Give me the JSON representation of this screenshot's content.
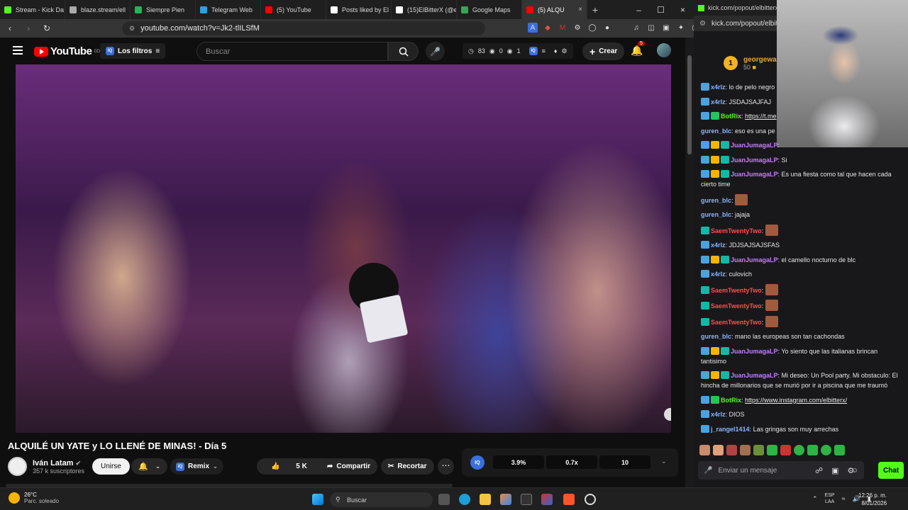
{
  "browser": {
    "tabs": [
      {
        "label": "Stream - Kick Da",
        "color": "#53fc18"
      },
      {
        "label": "blaze.stream/ell",
        "color": "#aaaaaa"
      },
      {
        "label": "Siempre Pien",
        "color": "#1db954"
      },
      {
        "label": "Telegram Web",
        "color": "#2aa3de"
      },
      {
        "label": "(5) YouTube",
        "color": "#ff0000"
      },
      {
        "label": "Posts liked by El",
        "color": "#ffffff"
      },
      {
        "label": "(15)ElBitterX (@e",
        "color": "#ffffff"
      },
      {
        "label": "Google Maps",
        "color": "#34a853"
      },
      {
        "label": "(5) ALQU",
        "color": "#ff0000"
      }
    ],
    "url": "youtube.com/watch?v=Jk2-tlILSfM"
  },
  "youtube": {
    "logo_text": "YouTube",
    "logo_country": "CO",
    "filter_label": "Los filtros",
    "search_placeholder": "Buscar",
    "stats": {
      "a": "83",
      "b": "0",
      "c": "1"
    },
    "create_label": "Crear",
    "notif_count": "5",
    "video_title": "ALQUILÉ UN YATE y LO LLENÉ DE MINAS! - Día 5",
    "channel_name": "Iván Latam",
    "subscribers": "357 k suscriptores",
    "join_label": "Unirse",
    "remix_label": "Remix",
    "likes": "5 K",
    "share_label": "Compartir",
    "clip_label": "Recortar",
    "speed": {
      "v1": "3.9%",
      "v2": "0.7x",
      "v3": "10"
    }
  },
  "kick": {
    "tab_url": "kick.com/popout/elbitterx/c",
    "url": "kick.com/popout/elbitterx/c",
    "gift_user": "georgewas",
    "gift_amount": "50",
    "messages": [
      {
        "user": "x4rlz",
        "color": "#8ab4ff",
        "text": "lo de pelo negro",
        "badges": [
          "#4aa3df"
        ]
      },
      {
        "user": "x4rlz",
        "color": "#8ab4ff",
        "text": "JSDAJSAJFAJ",
        "badges": [
          "#4aa3df"
        ]
      },
      {
        "user": "BotRix",
        "color": "#53fc18",
        "link": "https://t.me",
        "badges": [
          "#4aa3df",
          "#22c55e"
        ]
      },
      {
        "user": "guren_blc",
        "color": "#8ab4ff",
        "text": "eso es una pe",
        "badges": []
      },
      {
        "user": "JuanJumagaLP",
        "color": "#c77dff",
        "text": "",
        "badges": [
          "#4aa3df",
          "#f5b400",
          "#14b8a6"
        ]
      },
      {
        "user": "JuanJumagaLP",
        "color": "#c77dff",
        "text": "Si",
        "badges": [
          "#4aa3df",
          "#f5b400",
          "#14b8a6"
        ]
      },
      {
        "user": "JuanJumagaLP",
        "color": "#c77dff",
        "text": "Es una fiesta como tal que hacen cada cierto time",
        "badges": [
          "#4aa3df",
          "#f5b400",
          "#14b8a6"
        ]
      },
      {
        "user": "guren_blc",
        "color": "#8ab4ff",
        "emote": true,
        "badges": []
      },
      {
        "user": "guren_blc",
        "color": "#8ab4ff",
        "text": "jajaja",
        "badges": []
      },
      {
        "user": "SaemTwentyTwo",
        "color": "#ff4d4d",
        "emote": true,
        "badges": [
          "#14b8a6"
        ]
      },
      {
        "user": "x4rlz",
        "color": "#8ab4ff",
        "text": "JDJSAJSAJSFAS",
        "badges": [
          "#4aa3df"
        ]
      },
      {
        "user": "JuanJumagaLP",
        "color": "#c77dff",
        "text": "el camello nocturno de blc",
        "badges": [
          "#4aa3df",
          "#f5b400",
          "#14b8a6"
        ]
      },
      {
        "user": "x4rlz",
        "color": "#8ab4ff",
        "text": "culovich",
        "badges": [
          "#4aa3df"
        ]
      },
      {
        "user": "SaemTwentyTwo",
        "color": "#ff4d4d",
        "emote": true,
        "badges": [
          "#14b8a6"
        ]
      },
      {
        "user": "SaemTwentyTwo",
        "color": "#ff4d4d",
        "emote": true,
        "badges": [
          "#14b8a6"
        ]
      },
      {
        "user": "SaemTwentyTwo",
        "color": "#ff4d4d",
        "emote": true,
        "badges": [
          "#14b8a6"
        ]
      },
      {
        "user": "guren_blc",
        "color": "#8ab4ff",
        "text": "mano las europeas son tan cachondas",
        "badges": []
      },
      {
        "user": "JuanJumagaLP",
        "color": "#c77dff",
        "text": "Yo siento que las italianas brincan tantisimo",
        "badges": [
          "#4aa3df",
          "#f5b400",
          "#14b8a6"
        ]
      },
      {
        "user": "JuanJumagaLP",
        "color": "#c77dff",
        "text": "Mi deseo: Un Pool party. Mi obstaculo: El hincha de millonarios que se murió por ir a piscina que me traumó",
        "badges": [
          "#4aa3df",
          "#f5b400",
          "#14b8a6"
        ]
      },
      {
        "user": "BotRix",
        "color": "#53fc18",
        "link": "https://www.instagram.com/elbitterx/",
        "badges": [
          "#4aa3df",
          "#22c55e"
        ]
      },
      {
        "user": "x4rlz",
        "color": "#8ab4ff",
        "text": "DIOS",
        "badges": [
          "#4aa3df"
        ]
      },
      {
        "user": "j_rangel1414",
        "color": "#8ab4ff",
        "text": "Las gringas son muy arrechas",
        "badges": [
          "#4aa3df"
        ]
      }
    ],
    "input_placeholder": "Enviar un mensaje",
    "chat_button": "Chat"
  },
  "taskbar": {
    "temp": "26°C",
    "weather": "Parc. soleado",
    "search": "Buscar",
    "lang1": "ESP",
    "lang2": "LAA",
    "time": "12:26 p. m.",
    "date": "8/01/2026"
  }
}
